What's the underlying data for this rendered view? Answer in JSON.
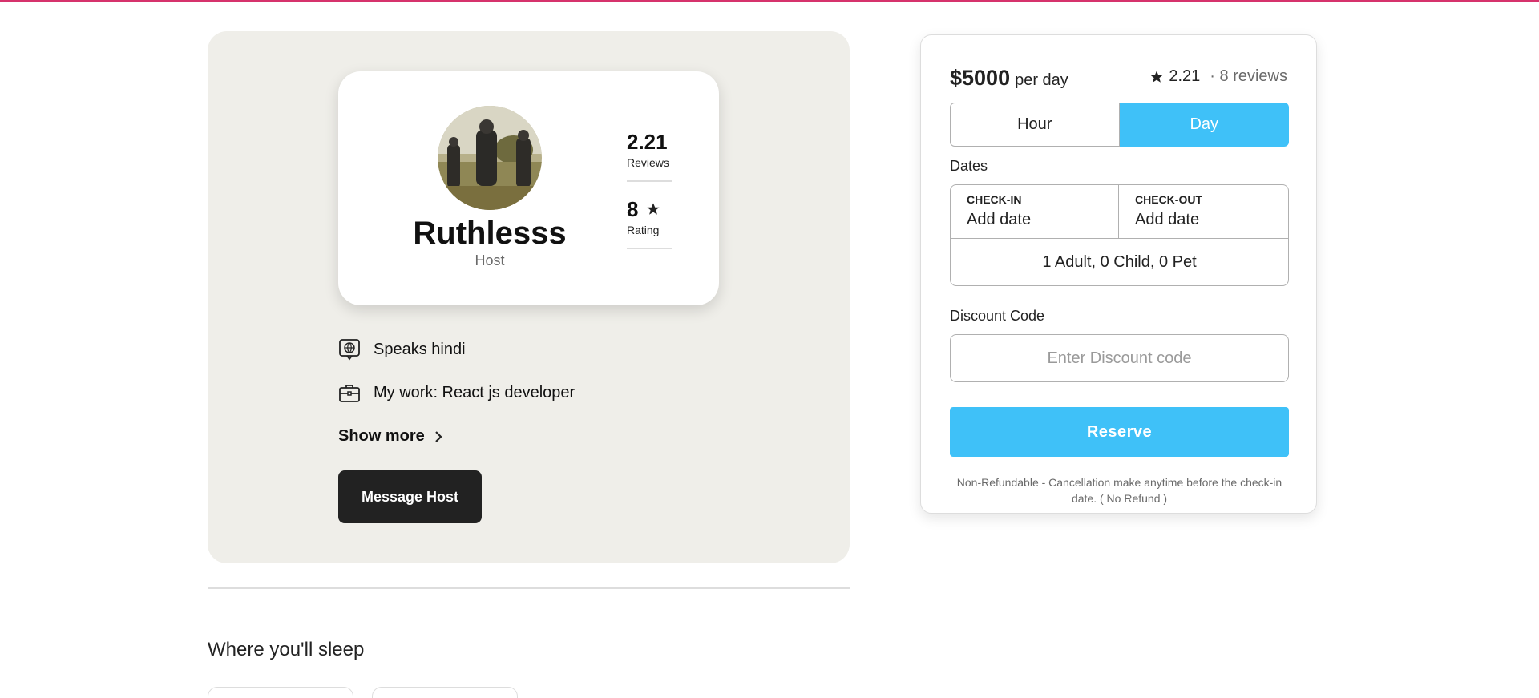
{
  "colors": {
    "accent": "#3fc1f8",
    "panel_bg": "#efeee9",
    "dark_button": "#222222",
    "top_line": "#d6336c"
  },
  "host": {
    "name": "Ruthlesss",
    "role": "Host",
    "avatar_icon": "host-avatar-photo",
    "stats": [
      {
        "value": "2.21",
        "label": "Reviews"
      },
      {
        "value": "8",
        "label": "Rating"
      }
    ],
    "details": [
      {
        "icon": "language-globe-icon",
        "text": "Speaks hindi"
      },
      {
        "icon": "briefcase-icon",
        "text": "My work: React js developer"
      }
    ],
    "show_more": "Show more",
    "message_button": "Message Host"
  },
  "sleep": {
    "title": "Where you'll sleep"
  },
  "booking": {
    "price": "$5000",
    "per": "per day",
    "rating": "2.21",
    "reviews": "· 8 reviews",
    "toggle": {
      "hour": "Hour",
      "day": "Day",
      "selected": "Day"
    },
    "dates_label": "Dates",
    "check_in_label": "CHECK-IN",
    "check_in_value": "Add date",
    "check_out_label": "CHECK-OUT",
    "check_out_value": "Add date",
    "guests": "1 Adult, 0 Child, 0 Pet",
    "discount_label": "Discount Code",
    "discount_placeholder": "Enter Discount code",
    "reserve": "Reserve",
    "note": "Non-Refundable - Cancellation make anytime before the check-in date. ( No Refund )"
  }
}
